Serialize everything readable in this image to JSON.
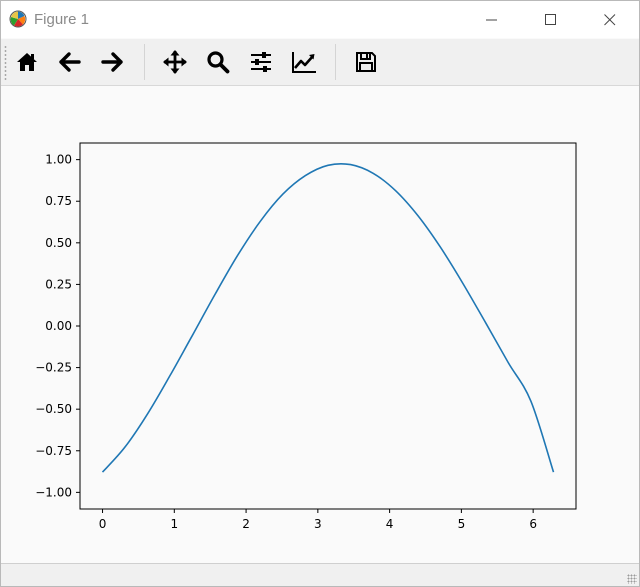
{
  "window": {
    "title": "Figure 1",
    "app_icon": "matplotlib-logo-icon",
    "controls": [
      "minimize-icon",
      "maximize-icon",
      "close-icon"
    ]
  },
  "toolbar": {
    "tools": [
      {
        "name": "home-button",
        "icon": "home-icon"
      },
      {
        "name": "back-button",
        "icon": "arrow-left-icon"
      },
      {
        "name": "forward-button",
        "icon": "arrow-right-icon"
      },
      {
        "name": "pan-button",
        "icon": "move-arrows-icon"
      },
      {
        "name": "zoom-button",
        "icon": "magnifier-icon"
      },
      {
        "name": "subplots-button",
        "icon": "sliders-icon"
      },
      {
        "name": "customize-button",
        "icon": "line-chart-icon"
      },
      {
        "name": "save-button",
        "icon": "floppy-disk-icon"
      }
    ]
  },
  "chart_data": {
    "type": "line",
    "title": "",
    "xlabel": "",
    "ylabel": "",
    "xlim": [
      -0.314,
      6.597
    ],
    "ylim": [
      -1.1,
      1.1
    ],
    "xticks": [
      "0",
      "1",
      "2",
      "3",
      "4",
      "5",
      "6"
    ],
    "yticks": [
      "1.00",
      "0.75",
      "0.50",
      "0.25",
      "0.00",
      "−0.25",
      "−0.50",
      "−0.75",
      "−1.00"
    ],
    "grid": false,
    "legend": "none",
    "line_color": "#1f77b4",
    "series": [
      {
        "x": [
          0.0,
          0.314,
          0.628,
          0.942,
          1.257,
          1.571,
          1.885,
          2.199,
          2.513,
          2.827,
          3.142,
          3.456,
          3.77,
          4.084,
          4.398,
          4.712,
          5.027,
          5.341,
          5.655,
          5.969,
          6.283
        ],
        "values": [
          -0.878,
          -0.727,
          -0.528,
          -0.297,
          -0.052,
          0.193,
          0.426,
          0.63,
          0.793,
          0.904,
          0.966,
          0.97,
          0.918,
          0.813,
          0.661,
          0.471,
          0.252,
          0.017,
          -0.222,
          -0.452,
          -0.878
        ]
      }
    ]
  }
}
